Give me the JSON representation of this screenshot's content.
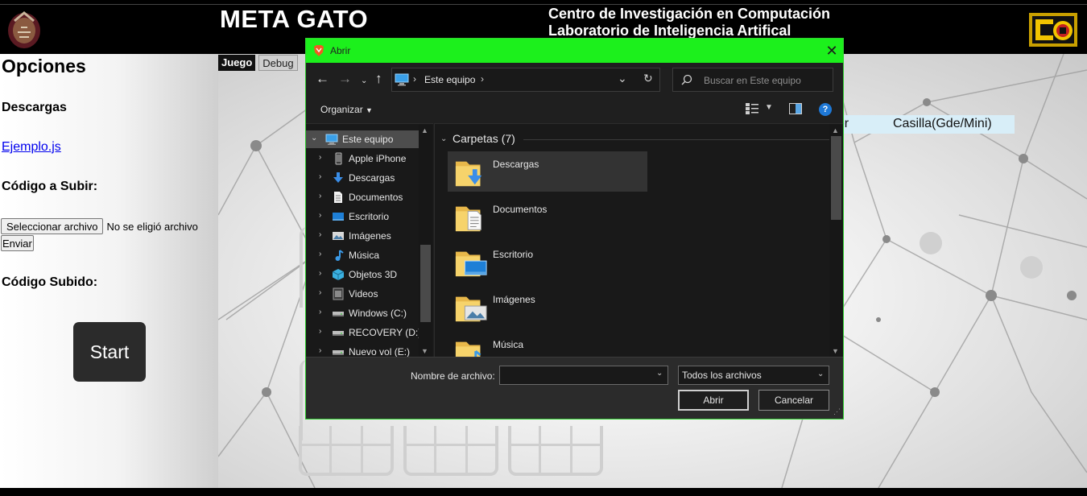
{
  "header": {
    "site_title": "META GATO",
    "center_line1": "Centro de Investigación en Computación",
    "center_line2": "Laboratorio de Inteligencia Artifical"
  },
  "sidebar": {
    "title": "Opciones",
    "downloads_heading": "Descargas",
    "example_link": "Ejemplo.js",
    "upload_heading": "Código a Subir:",
    "choose_file_button": "Seleccionar archivo",
    "no_file_text": "No se eligió archivo",
    "send_button": "Enviar",
    "uploaded_heading": "Código Subido:",
    "start_button": "Start"
  },
  "main": {
    "tabs": [
      {
        "label": "Juego",
        "active": true
      },
      {
        "label": "Debug",
        "active": false
      }
    ],
    "table_headers": [
      "dor",
      "Casilla(Gde/Mini)"
    ]
  },
  "dialog": {
    "title": "Abrir",
    "address_path": "Este equipo",
    "search_placeholder": "Buscar en Este equipo",
    "organize_label": "Organizar",
    "nav_items": [
      {
        "label": "Este equipo",
        "icon": "pc-icon",
        "selected": true,
        "expanded": true
      },
      {
        "label": "Apple iPhone",
        "icon": "phone-icon"
      },
      {
        "label": "Descargas",
        "icon": "download-icon"
      },
      {
        "label": "Documentos",
        "icon": "document-icon"
      },
      {
        "label": "Escritorio",
        "icon": "desktop-icon"
      },
      {
        "label": "Imágenes",
        "icon": "pictures-icon"
      },
      {
        "label": "Música",
        "icon": "music-icon"
      },
      {
        "label": "Objetos 3D",
        "icon": "cube-icon"
      },
      {
        "label": "Videos",
        "icon": "video-icon"
      },
      {
        "label": "Windows (C:)",
        "icon": "drive-icon"
      },
      {
        "label": "RECOVERY (D:)",
        "icon": "drive-icon"
      },
      {
        "label": "Nuevo vol (E:)",
        "icon": "drive-icon"
      }
    ],
    "group_title": "Carpetas (7)",
    "folders": [
      {
        "label": "Descargas",
        "overlay": "download",
        "selected": true
      },
      {
        "label": "Documentos",
        "overlay": "document"
      },
      {
        "label": "Escritorio",
        "overlay": "desktop"
      },
      {
        "label": "Imágenes",
        "overlay": "pictures"
      },
      {
        "label": "Música",
        "overlay": "music"
      }
    ],
    "filename_label": "Nombre de archivo:",
    "filename_value": "",
    "filetype_value": "Todos los archivos",
    "open_button": "Abrir",
    "cancel_button": "Cancelar"
  },
  "colors": {
    "dialog_titlebar": "#1cf01c",
    "dialog_bg": "#1f1f1f",
    "start_button": "#2b2b2b",
    "table_header_bg": "#d8eef8",
    "link": "#0000ee"
  }
}
